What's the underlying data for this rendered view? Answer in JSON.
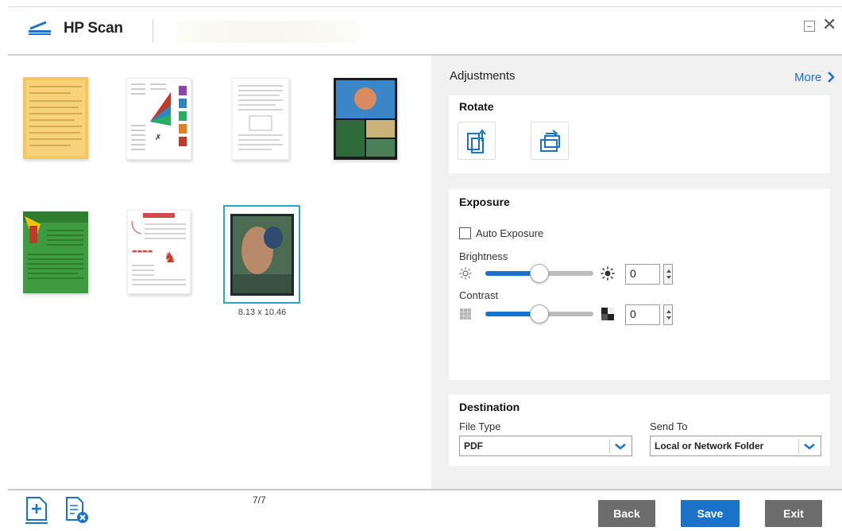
{
  "app": {
    "title": "HP Scan",
    "window_controls": {
      "minimize_icon": "minimize-icon",
      "close": "✕"
    }
  },
  "thumbnails": {
    "items": [
      {
        "name": "thumb-page-1",
        "description_icon": "yellow-document"
      },
      {
        "name": "thumb-page-2",
        "description_icon": "brochure-pyramid"
      },
      {
        "name": "thumb-page-3",
        "description_icon": "text-document"
      },
      {
        "name": "thumb-page-4",
        "description_icon": "photo-collage"
      },
      {
        "name": "thumb-page-5",
        "description_icon": "green-flyer"
      },
      {
        "name": "thumb-page-6",
        "description_icon": "newsletter"
      },
      {
        "name": "thumb-page-7",
        "description_icon": "photo",
        "selected": true
      }
    ],
    "selected_dimensions": "8.13 x 10.46"
  },
  "panel": {
    "title": "Adjustments",
    "more_label": "More",
    "rotate": {
      "title": "Rotate",
      "left_icon": "rotate-left-icon",
      "right_icon": "rotate-right-icon"
    },
    "exposure": {
      "title": "Exposure",
      "auto_label": "Auto Exposure",
      "auto_checked": false,
      "brightness_label": "Brightness",
      "brightness_value": "0",
      "brightness_fraction": 0.5,
      "contrast_label": "Contrast",
      "contrast_value": "0",
      "contrast_fraction": 0.5
    },
    "destination": {
      "title": "Destination",
      "file_type_label": "File Type",
      "file_type_value": "PDF",
      "send_to_label": "Send To",
      "send_to_value": "Local or Network Folder"
    }
  },
  "footer": {
    "page_count": "7/7",
    "add_page_icon": "add-page-icon",
    "delete_page_icon": "delete-page-icon",
    "back_label": "Back",
    "save_label": "Save",
    "exit_label": "Exit"
  },
  "colors": {
    "accent": "#1a73c8",
    "panel_bg": "#f0f0f0",
    "button_gray": "#6c6c6c"
  }
}
